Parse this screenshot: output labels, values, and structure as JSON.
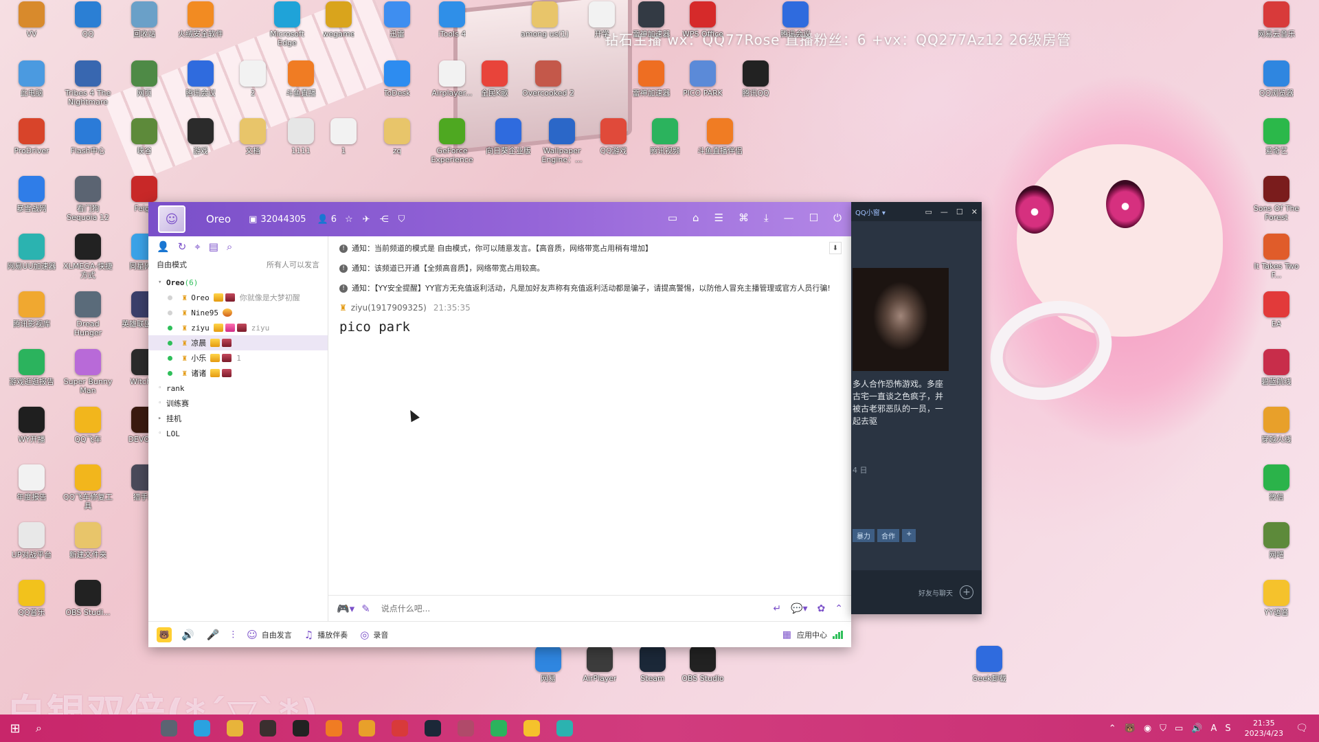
{
  "wallpaper": {
    "caption": "钻石主播  wx：QQ77Rose    直播粉丝：6  +vx：QQ277Az12 26级房管",
    "bigtext": "白银双倍(*ˊ▽ˋ*)"
  },
  "desktop_icons": [
    {
      "label": "VV",
      "color": "#d88a2c"
    },
    {
      "label": "QQ",
      "color": "#2b7fd4"
    },
    {
      "label": "回收站",
      "color": "#6aa0c8"
    },
    {
      "label": "火绒安全软件",
      "color": "#f28b22"
    },
    {
      "label": "Microsoft Edge",
      "color": "#1fa3d8"
    },
    {
      "label": "wegame",
      "color": "#d9a41c"
    },
    {
      "label": "迅雷",
      "color": "#3e8ef0"
    },
    {
      "label": "iTools 4",
      "color": "#2f8fe8"
    },
    {
      "label": "among us(1)",
      "color": "#e8c56a"
    },
    {
      "label": "开学",
      "color": "#f2f2f2"
    },
    {
      "label": "雷神加速器",
      "color": "#333a44"
    },
    {
      "label": "WPS Office",
      "color": "#d62a2a"
    },
    {
      "label": "腾讯会议",
      "color": "#2f6bde"
    },
    {
      "label": "网易云音乐",
      "color": "#d83a3a"
    },
    {
      "label": "此电脑",
      "color": "#4b9ae0"
    },
    {
      "label": "Tribes 4 The Nightmare",
      "color": "#3867b0"
    },
    {
      "label": "网页",
      "color": "#4e8a46"
    },
    {
      "label": "腾讯会议",
      "color": "#2f6bde"
    },
    {
      "label": "2",
      "color": "#f2f2f2"
    },
    {
      "label": "斗鱼直播",
      "color": "#f07c23"
    },
    {
      "label": "ToDesk",
      "color": "#2d8cf0"
    },
    {
      "label": "Airplayer...",
      "color": "#f2f2f2"
    },
    {
      "label": "全民K歌",
      "color": "#e8443a"
    },
    {
      "label": "Overcooked 2",
      "color": "#c4584a"
    },
    {
      "label": "雷神加速器",
      "color": "#ee6e22"
    },
    {
      "label": "PICO PARK",
      "color": "#5b8ad8"
    },
    {
      "label": "腾讯QQ",
      "color": "#222222"
    },
    {
      "label": "QQ浏览器",
      "color": "#2f86e0"
    },
    {
      "label": "ProDriver",
      "color": "#d8442a"
    },
    {
      "label": "Flash中心",
      "color": "#2b7bd8"
    },
    {
      "label": "峡谷",
      "color": "#5d8a3a"
    },
    {
      "label": "游戏",
      "color": "#2b2b2b"
    },
    {
      "label": "文档",
      "color": "#e8c56a"
    },
    {
      "label": "1111",
      "color": "#e6e6e6"
    },
    {
      "label": "1",
      "color": "#f2f2f2"
    },
    {
      "label": "zq",
      "color": "#e8c56a"
    },
    {
      "label": "GeForce Experience",
      "color": "#4ea821"
    },
    {
      "label": "向日葵企业版",
      "color": "#2f6bde"
    },
    {
      "label": "Wallpaper Engine：...",
      "color": "#2b67c8"
    },
    {
      "label": "QQ游戏",
      "color": "#e04a3a"
    },
    {
      "label": "腾讯视频",
      "color": "#2bb35d"
    },
    {
      "label": "斗鱼直播伴侣",
      "color": "#f07c23"
    },
    {
      "label": "爱奇艺",
      "color": "#2bb84a"
    },
    {
      "label": "暴雪战网",
      "color": "#2f7de8"
    },
    {
      "label": "看门狗 Sequoia 12",
      "color": "#5b6472"
    },
    {
      "label": "Feign",
      "color": "#c82828"
    },
    {
      "label": "Sons Of The Forest",
      "color": "#7a1c1c"
    },
    {
      "label": "网易UU加速器",
      "color": "#2bb3b0"
    },
    {
      "label": "XLMEGA-快捷方式",
      "color": "#222222"
    },
    {
      "label": "同星网盘",
      "color": "#3ba3e8"
    },
    {
      "label": "It Takes Two F...",
      "color": "#e05c2a"
    },
    {
      "label": "腾讯影视库",
      "color": "#f0a830"
    },
    {
      "label": "Dread Hunger",
      "color": "#5a6b7a"
    },
    {
      "label": "英雄联盟平台",
      "color": "#3a3f6a"
    },
    {
      "label": "EA",
      "color": "#e23a3a"
    },
    {
      "label": "游戏逛逛报告",
      "color": "#2bb35d"
    },
    {
      "label": "Super Bunny Man",
      "color": "#b86ad8"
    },
    {
      "label": "Witch It",
      "color": "#2b2b2b"
    },
    {
      "label": "碧蓝航线",
      "color": "#c82d4a"
    },
    {
      "label": "WY开播",
      "color": "#1f1f1f"
    },
    {
      "label": "QQ飞车",
      "color": "#f2b61c"
    },
    {
      "label": "DEVOUR",
      "color": "#3a1a10"
    },
    {
      "label": "穿越火线",
      "color": "#e8a02a"
    },
    {
      "label": "年度报告",
      "color": "#f2f2f2"
    },
    {
      "label": "QQ飞车修复工具",
      "color": "#f2b61c"
    },
    {
      "label": "猎手游",
      "color": "#4a4a5a"
    },
    {
      "label": "微信",
      "color": "#2bb34a"
    },
    {
      "label": "UP对战平台",
      "color": "#e8e8e8"
    },
    {
      "label": "新建文件夹",
      "color": "#e8c56a"
    },
    {
      "label": "网吧",
      "color": "#5d8a3a"
    },
    {
      "label": "QQ音乐",
      "color": "#f2c21c"
    },
    {
      "label": "OBS Studi...",
      "color": "#222222"
    },
    {
      "label": "网易",
      "color": "#2f86e0"
    },
    {
      "label": "AirPlayer",
      "color": "#3c3c3c"
    },
    {
      "label": "Steam",
      "color": "#1b2838"
    },
    {
      "label": "OBS Studio",
      "color": "#222222"
    },
    {
      "label": "YY语音",
      "color": "#f5c22c"
    },
    {
      "label": "Geek卸载",
      "color": "#2f6bde"
    }
  ],
  "yy": {
    "channel_name": "Oreo",
    "channel_id": "32044305",
    "online_count": "6",
    "mode_label": "自由模式",
    "perm_label": "所有人可以发言",
    "group_name": "Oreo",
    "group_count": "(6)",
    "members": [
      {
        "name": "Oreo",
        "online": false,
        "signature": "你就像是大梦初醒",
        "badges": [
          "crown",
          "lvl"
        ]
      },
      {
        "name": "Nine95",
        "online": false,
        "signature": "",
        "badges": [
          "gold"
        ]
      },
      {
        "name": "ziyu",
        "online": true,
        "signature": "ziyu",
        "badges": [
          "crown",
          "heart",
          "lvl"
        ]
      },
      {
        "name": "凉晨",
        "online": true,
        "signature": "",
        "badges": [
          "crown",
          "lvl"
        ],
        "selected": true
      },
      {
        "name": "小乐",
        "online": true,
        "signature": "1",
        "badges": [
          "crown",
          "lvl"
        ]
      },
      {
        "name": "诸诸",
        "online": true,
        "signature": "",
        "badges": [
          "crown",
          "lvl"
        ]
      }
    ],
    "sub_channels": [
      "rank",
      "训练赛",
      "挂机",
      "LOL"
    ],
    "notices": [
      "通知：当前频道的模式是 自由模式，你可以随意发言。【高音质，网络带宽占用稍有增加】",
      "通知：该频道已开通【全频高音质】，网络带宽占用较高。",
      "通知：【YY安全提醒】YY官方无充值返利活动，凡是加好友声称有充值返利活动都是骗子，请提高警惕，以防他人冒充主播管理或官方人员行骗!"
    ],
    "message": {
      "sender": "ziyu(1917909325)",
      "time": "21:35:35",
      "text": "pico park"
    },
    "input_placeholder": "说点什么吧...",
    "bottom": {
      "free_speak": "自由发言",
      "play_accompany": "播放伴奏",
      "record": "录音",
      "app_center": "应用中心"
    }
  },
  "side_panel": {
    "top_label": "QQ小窗 ▾",
    "description": "多人合作恐怖游戏。多座古宅一直谈之色疯子，并被古老邪恶队的一员，一起去驱",
    "date": "4 日",
    "tags": [
      "暴力",
      "合作",
      "+"
    ],
    "foot_label": "好友与聊天"
  },
  "taskbar": {
    "clock_time": "21:35",
    "clock_date": "2023/4/23",
    "ime": "A"
  }
}
